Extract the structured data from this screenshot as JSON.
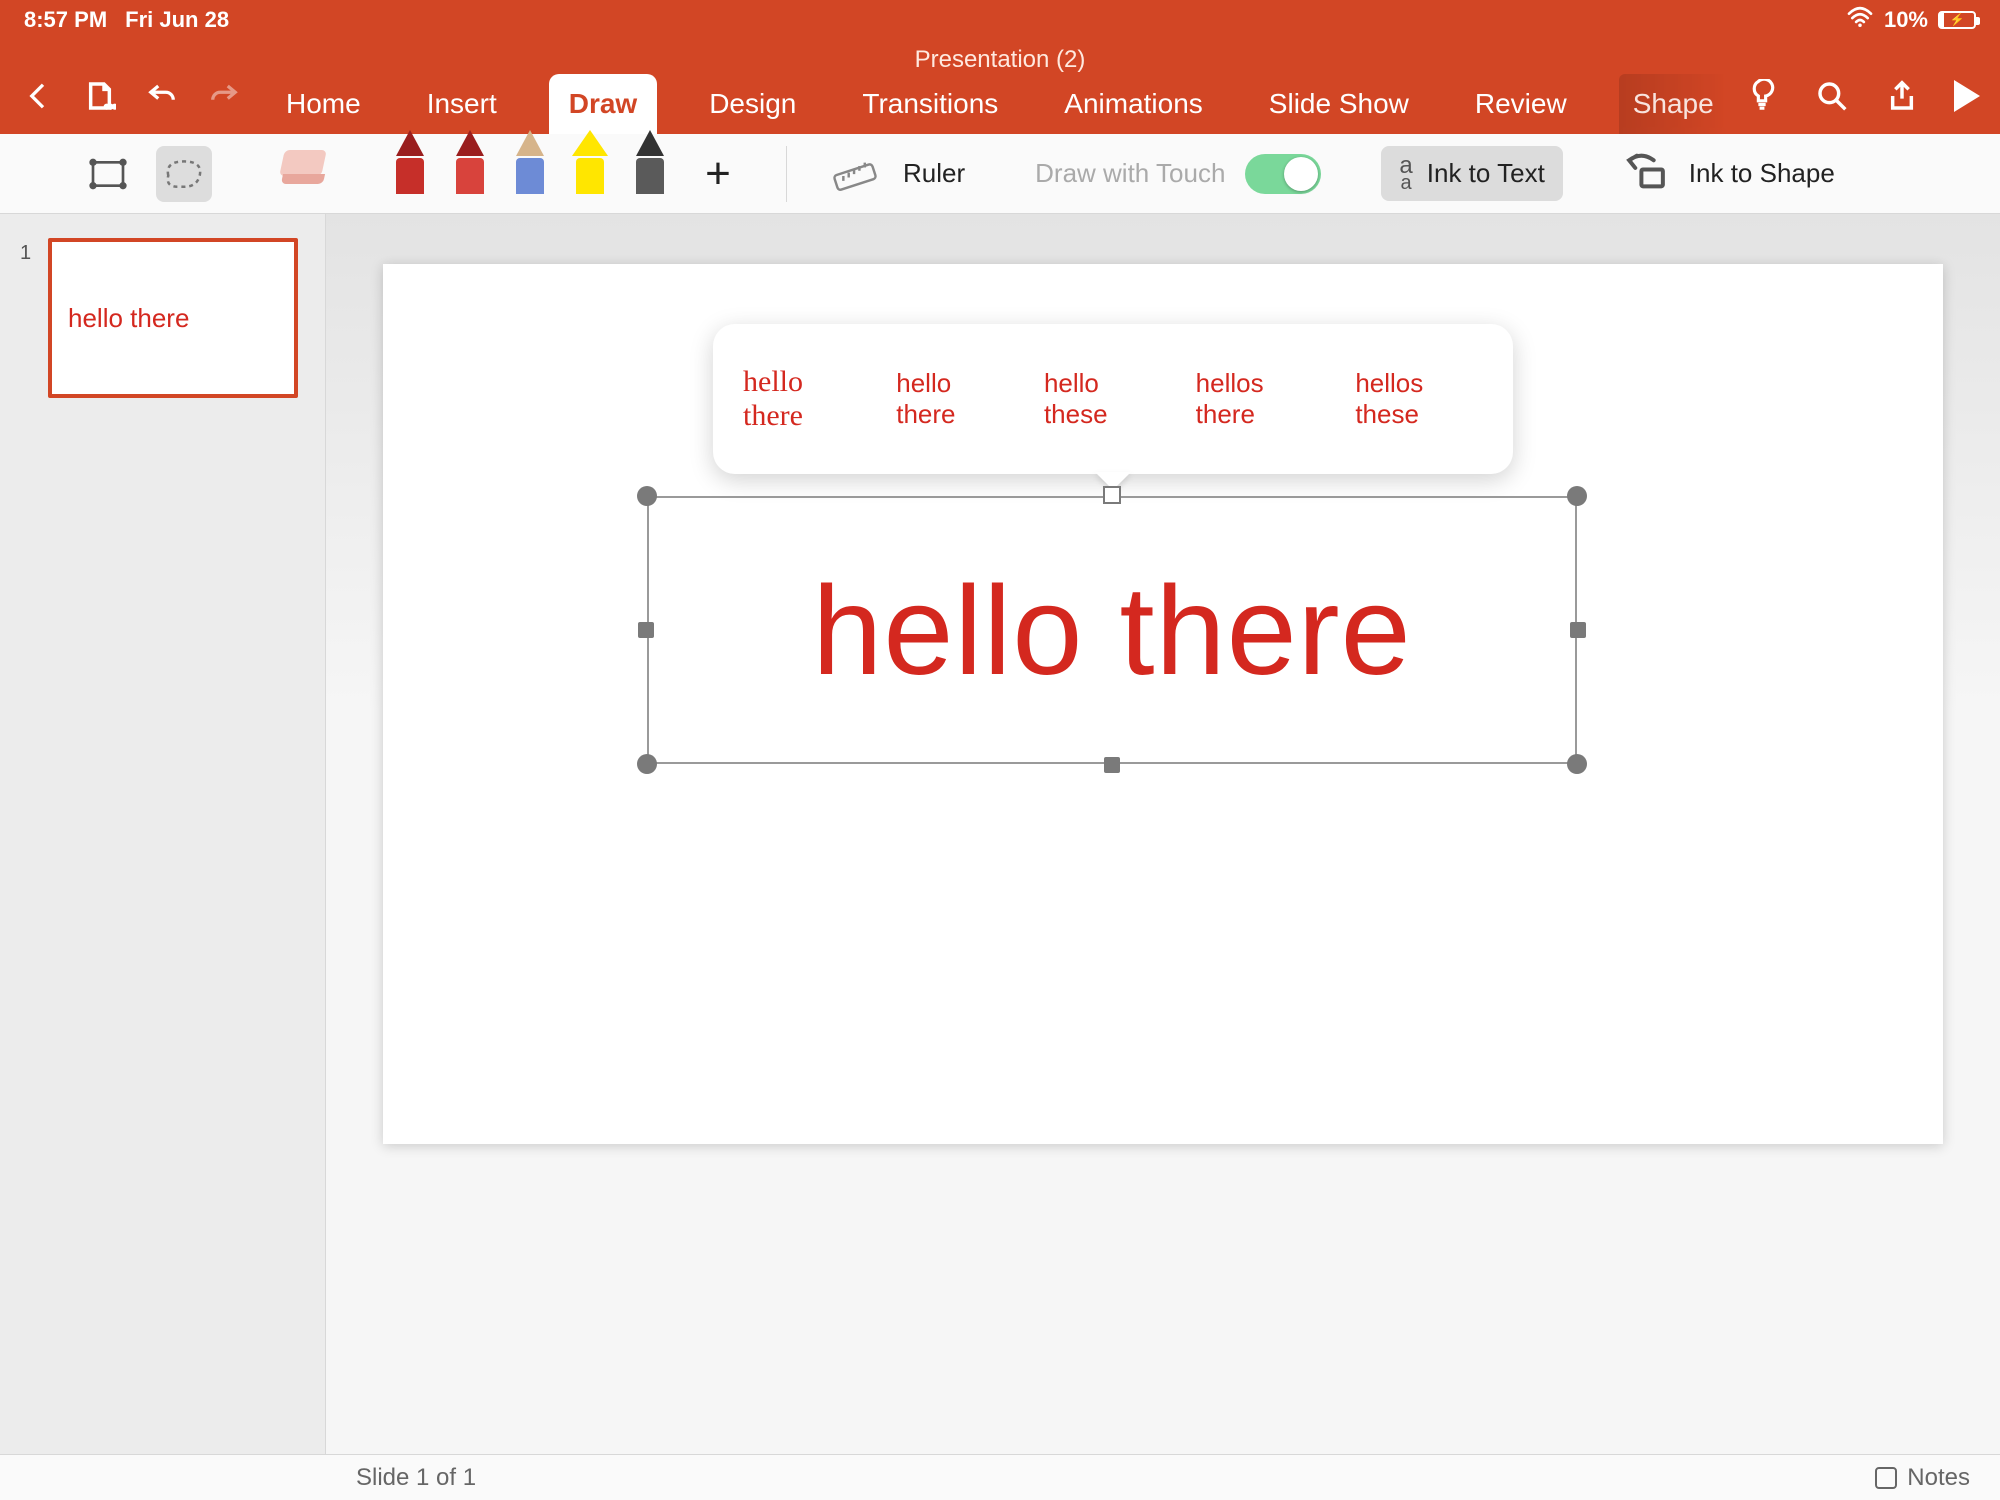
{
  "status": {
    "time": "8:57 PM",
    "date": "Fri Jun 28",
    "battery": "10%"
  },
  "doc": {
    "title": "Presentation (2)"
  },
  "ribbon": {
    "tabs": [
      "Home",
      "Insert",
      "Draw",
      "Design",
      "Transitions",
      "Animations",
      "Slide Show",
      "Review",
      "Shape"
    ],
    "active": "Draw"
  },
  "draw": {
    "ruler": "Ruler",
    "drawtouch": "Draw with Touch",
    "inktext": "Ink to Text",
    "inkshape": "Ink to Shape"
  },
  "thumbs": {
    "n1": "1",
    "t1": "hello there"
  },
  "popup": {
    "hand": "hello there",
    "s1": "hello there",
    "s2": "hello these",
    "s3": "hellos there",
    "s4": "hellos these"
  },
  "slide": {
    "text": "hello there"
  },
  "footer": {
    "pos": "Slide 1 of 1",
    "notes": "Notes"
  }
}
